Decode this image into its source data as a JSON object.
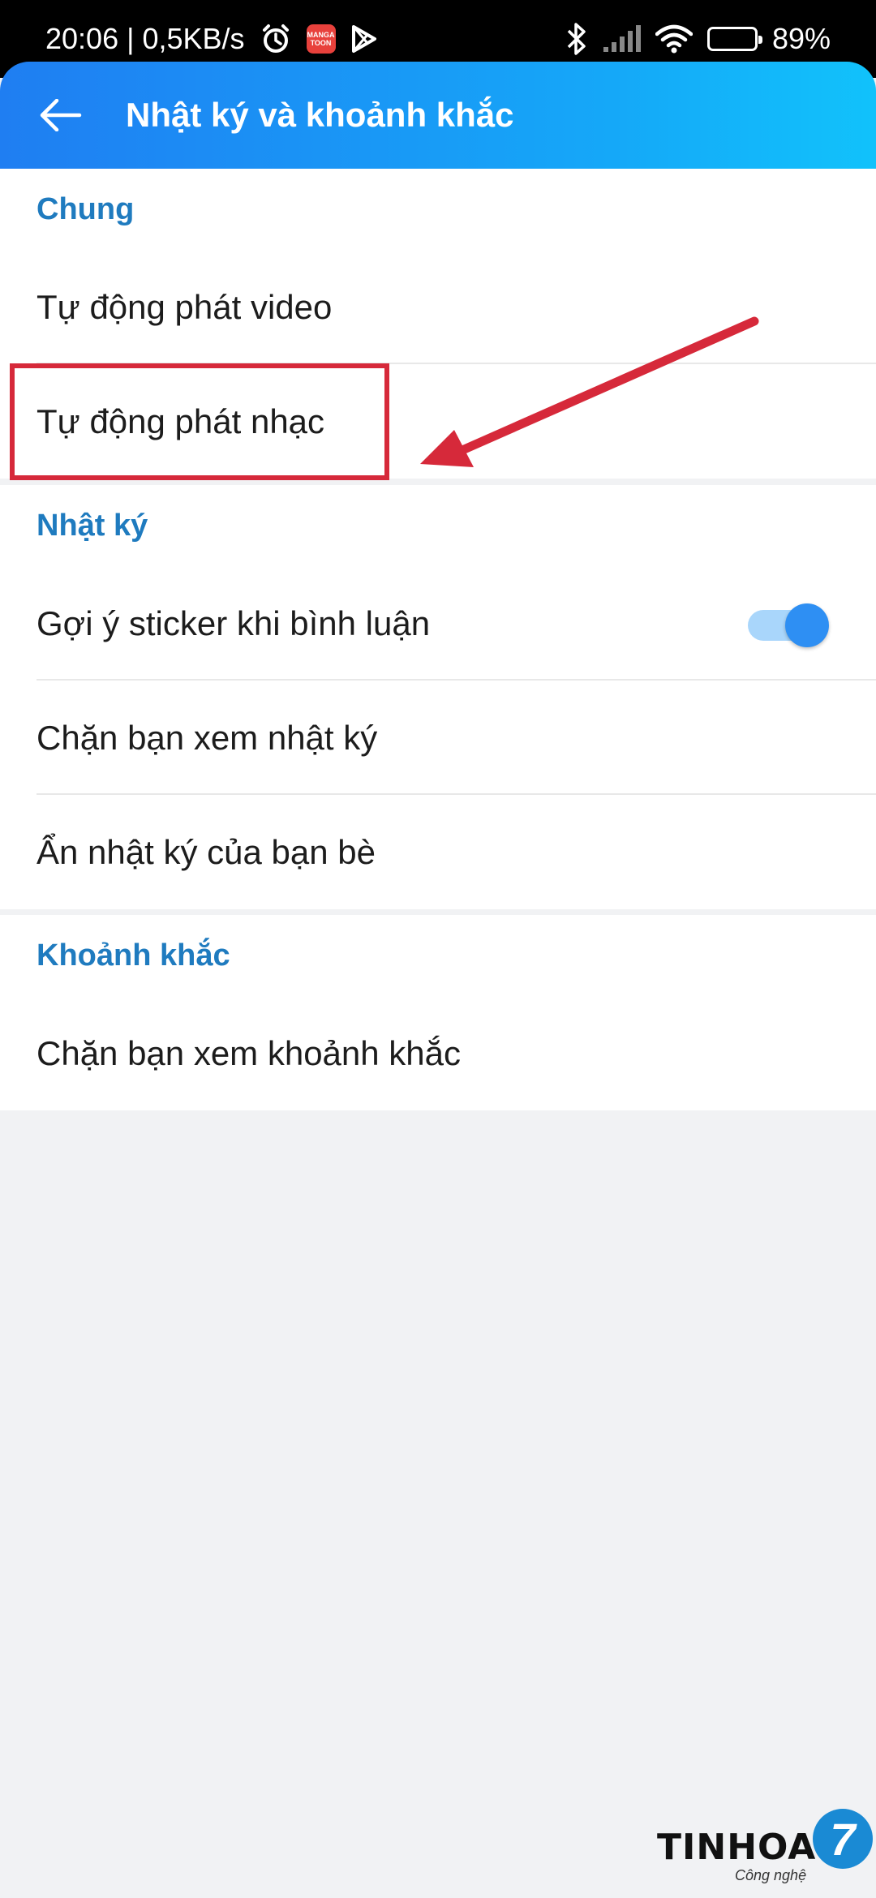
{
  "status_bar": {
    "time_speed": "20:06 | 0,5KB/s",
    "battery": "89%",
    "battery_level": 0.89,
    "app_badge_line1": "MANGA",
    "app_badge_line2": "TOON"
  },
  "header": {
    "title": "Nhật ký và khoảnh khắc"
  },
  "sections": {
    "general": {
      "title": "Chung",
      "items": [
        "Tự động phát video",
        "Tự động phát nhạc"
      ]
    },
    "diary": {
      "title": "Nhật ký",
      "items": [
        "Gợi ý sticker khi bình luận",
        "Chặn bạn xem nhật ký",
        "Ẩn nhật ký của bạn bè"
      ],
      "sticker_toggle_on": true
    },
    "moments": {
      "title": "Khoảnh khắc",
      "items": [
        "Chặn bạn xem khoảnh khắc"
      ]
    }
  },
  "annotation": {
    "color": "#d6293a"
  },
  "watermark": {
    "brand": "TINHOA",
    "number": "7",
    "tagline": "Công nghệ"
  }
}
